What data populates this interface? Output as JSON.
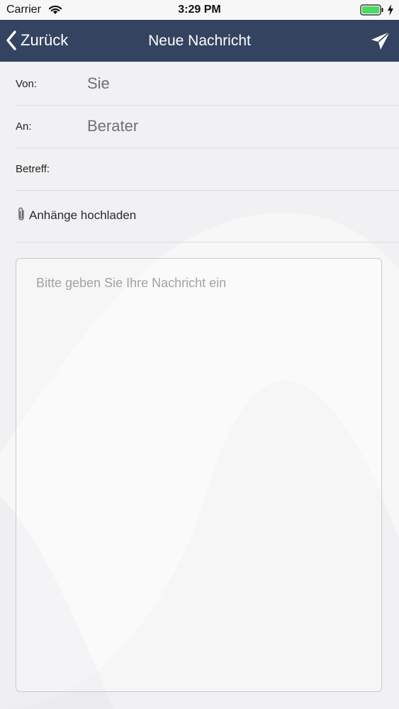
{
  "status_bar": {
    "carrier": "Carrier",
    "time": "3:29 PM",
    "icons": [
      "wifi-icon",
      "battery-icon",
      "charging-bolt-icon"
    ],
    "battery_color": "#4cd964"
  },
  "nav": {
    "back_label": "Zurück",
    "title": "Neue Nachricht",
    "back_icon": "chevron-left-icon",
    "send_icon": "paper-plane-icon",
    "background_color": "#34435f"
  },
  "form": {
    "from_label": "Von:",
    "from_value": "Sie",
    "to_label": "An:",
    "to_value": "Berater",
    "subject_label": "Betreff:",
    "subject_value": ""
  },
  "attachments": {
    "icon": "paperclip-icon",
    "label": "Anhänge hochladen"
  },
  "message": {
    "placeholder": "Bitte geben Sie Ihre Nachricht ein",
    "value": ""
  }
}
